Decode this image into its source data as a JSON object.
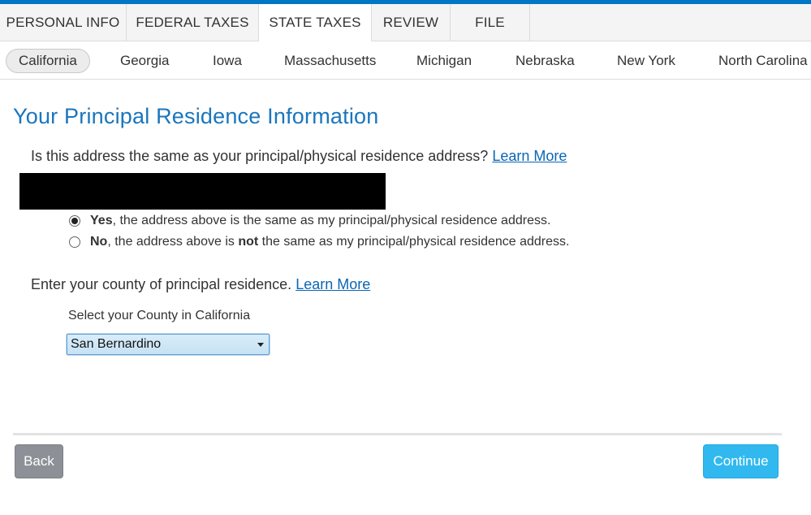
{
  "colors": {
    "accent": "#0077c5",
    "title": "#1a76bd",
    "link": "#0b66b3",
    "continue": "#31b9ef",
    "back": "#8d9096"
  },
  "main_tabs": [
    {
      "label": "PERSONAL INFO"
    },
    {
      "label": "FEDERAL TAXES"
    },
    {
      "label": "STATE TAXES",
      "active": true
    },
    {
      "label": "REVIEW"
    },
    {
      "label": "FILE"
    }
  ],
  "state_tabs": [
    {
      "label": "California",
      "active": true
    },
    {
      "label": "Georgia"
    },
    {
      "label": "Iowa"
    },
    {
      "label": "Massachusetts"
    },
    {
      "label": "Michigan"
    },
    {
      "label": "Nebraska"
    },
    {
      "label": "New York"
    },
    {
      "label": "North Carolina"
    }
  ],
  "page": {
    "title": "Your Principal Residence Information",
    "address_question": "Is this address the same as your principal/physical residence address?",
    "learn_more": "Learn More",
    "options": {
      "yes_bold": "Yes",
      "yes_text": ", the address above is the same as my principal/physical residence address.",
      "no_bold": "No",
      "no_text_1": ", the address above is ",
      "no_not": "not",
      "no_text_2": " the same as my principal/physical residence address.",
      "selected": "yes"
    },
    "county_question": "Enter your county of principal residence.",
    "county_label": "Select your County in California",
    "county_value": "San Bernardino"
  },
  "footer": {
    "back_label": "Back",
    "continue_label": "Continue"
  }
}
